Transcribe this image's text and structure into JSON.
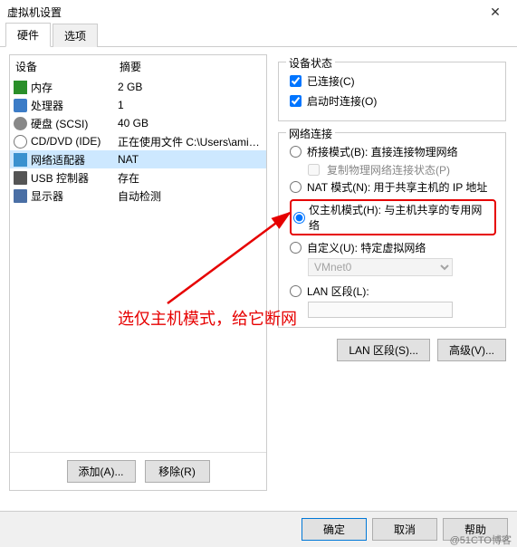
{
  "window": {
    "title": "虚拟机设置"
  },
  "tabs": {
    "hardware": "硬件",
    "options": "选项"
  },
  "device_list": {
    "header_device": "设备",
    "header_summary": "摘要",
    "rows": [
      {
        "name": "内存",
        "summary": "2 GB",
        "icon": "memory"
      },
      {
        "name": "处理器",
        "summary": "1",
        "icon": "cpu"
      },
      {
        "name": "硬盘 (SCSI)",
        "summary": "40 GB",
        "icon": "disk"
      },
      {
        "name": "CD/DVD (IDE)",
        "summary": "正在使用文件 C:\\Users\\aming\\...",
        "icon": "cd"
      },
      {
        "name": "网络适配器",
        "summary": "NAT",
        "icon": "net"
      },
      {
        "name": "USB 控制器",
        "summary": "存在",
        "icon": "usb"
      },
      {
        "name": "显示器",
        "summary": "自动检测",
        "icon": "display"
      }
    ]
  },
  "left_buttons": {
    "add": "添加(A)...",
    "remove": "移除(R)"
  },
  "status": {
    "title": "设备状态",
    "connected": "已连接(C)",
    "connect_on_power": "启动时连接(O)"
  },
  "network": {
    "title": "网络连接",
    "bridged": "桥接模式(B): 直接连接物理网络",
    "replicate": "复制物理网络连接状态(P)",
    "nat": "NAT 模式(N): 用于共享主机的 IP 地址",
    "hostonly": "仅主机模式(H): 与主机共享的专用网络",
    "custom": "自定义(U): 特定虚拟网络",
    "vmnet_value": "VMnet0",
    "lan": "LAN 区段(L):"
  },
  "right_buttons": {
    "lan_segments": "LAN 区段(S)...",
    "advanced": "高级(V)..."
  },
  "footer": {
    "ok": "确定",
    "cancel": "取消",
    "help": "帮助"
  },
  "annotation": {
    "text": "选仅主机模式，给它断网"
  },
  "watermark": "@51CTO博客"
}
